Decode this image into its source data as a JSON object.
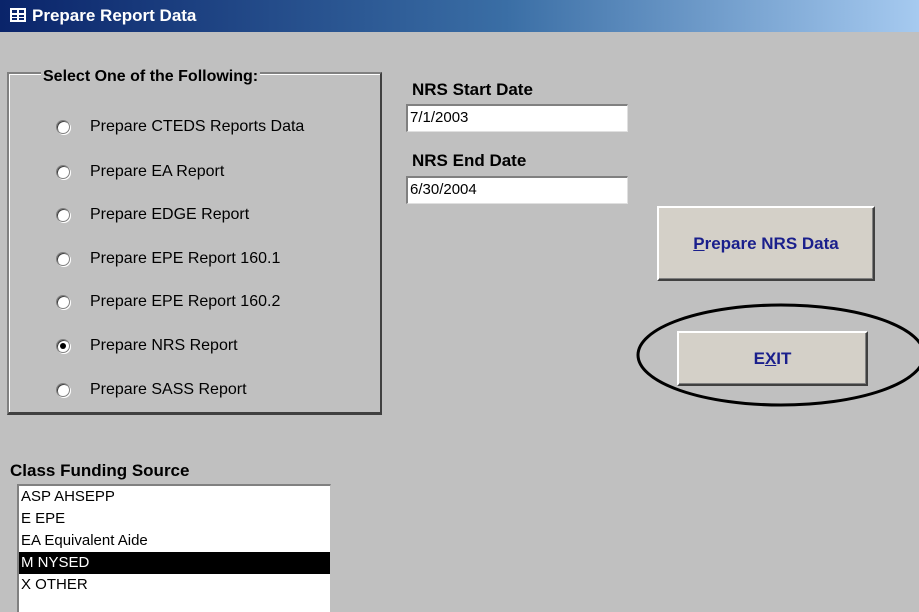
{
  "window": {
    "title": "Prepare Report Data"
  },
  "report_group": {
    "title": "Select One of the Following:",
    "options": [
      {
        "label": "Prepare CTEDS Reports Data",
        "checked": false
      },
      {
        "label": "Prepare EA Report",
        "checked": false
      },
      {
        "label": "Prepare EDGE Report",
        "checked": false
      },
      {
        "label": "Prepare EPE Report 160.1",
        "checked": false
      },
      {
        "label": "Prepare EPE Report 160.2",
        "checked": false
      },
      {
        "label": "Prepare NRS Report",
        "checked": true
      },
      {
        "label": "Prepare SASS Report",
        "checked": false
      }
    ]
  },
  "dates": {
    "start_label": "NRS Start Date",
    "start_value": "7/1/2003",
    "end_label": "NRS End Date",
    "end_value": "6/30/2004"
  },
  "buttons": {
    "prepare_accel": "P",
    "prepare_rest": "repare NRS Data",
    "exit_pre": "E",
    "exit_accel": "X",
    "exit_post": "IT"
  },
  "funding": {
    "label": "Class Funding Source",
    "items": [
      {
        "text": "ASP AHSEPP",
        "selected": false
      },
      {
        "text": "E  EPE",
        "selected": false
      },
      {
        "text": "EA  Equivalent Aide",
        "selected": false
      },
      {
        "text": "M  NYSED",
        "selected": true
      },
      {
        "text": "X  OTHER",
        "selected": false
      }
    ]
  },
  "colors": {
    "title_gradient_start": "#0a246a",
    "button_text": "#1a1f8c",
    "selection_bg": "#000000"
  }
}
